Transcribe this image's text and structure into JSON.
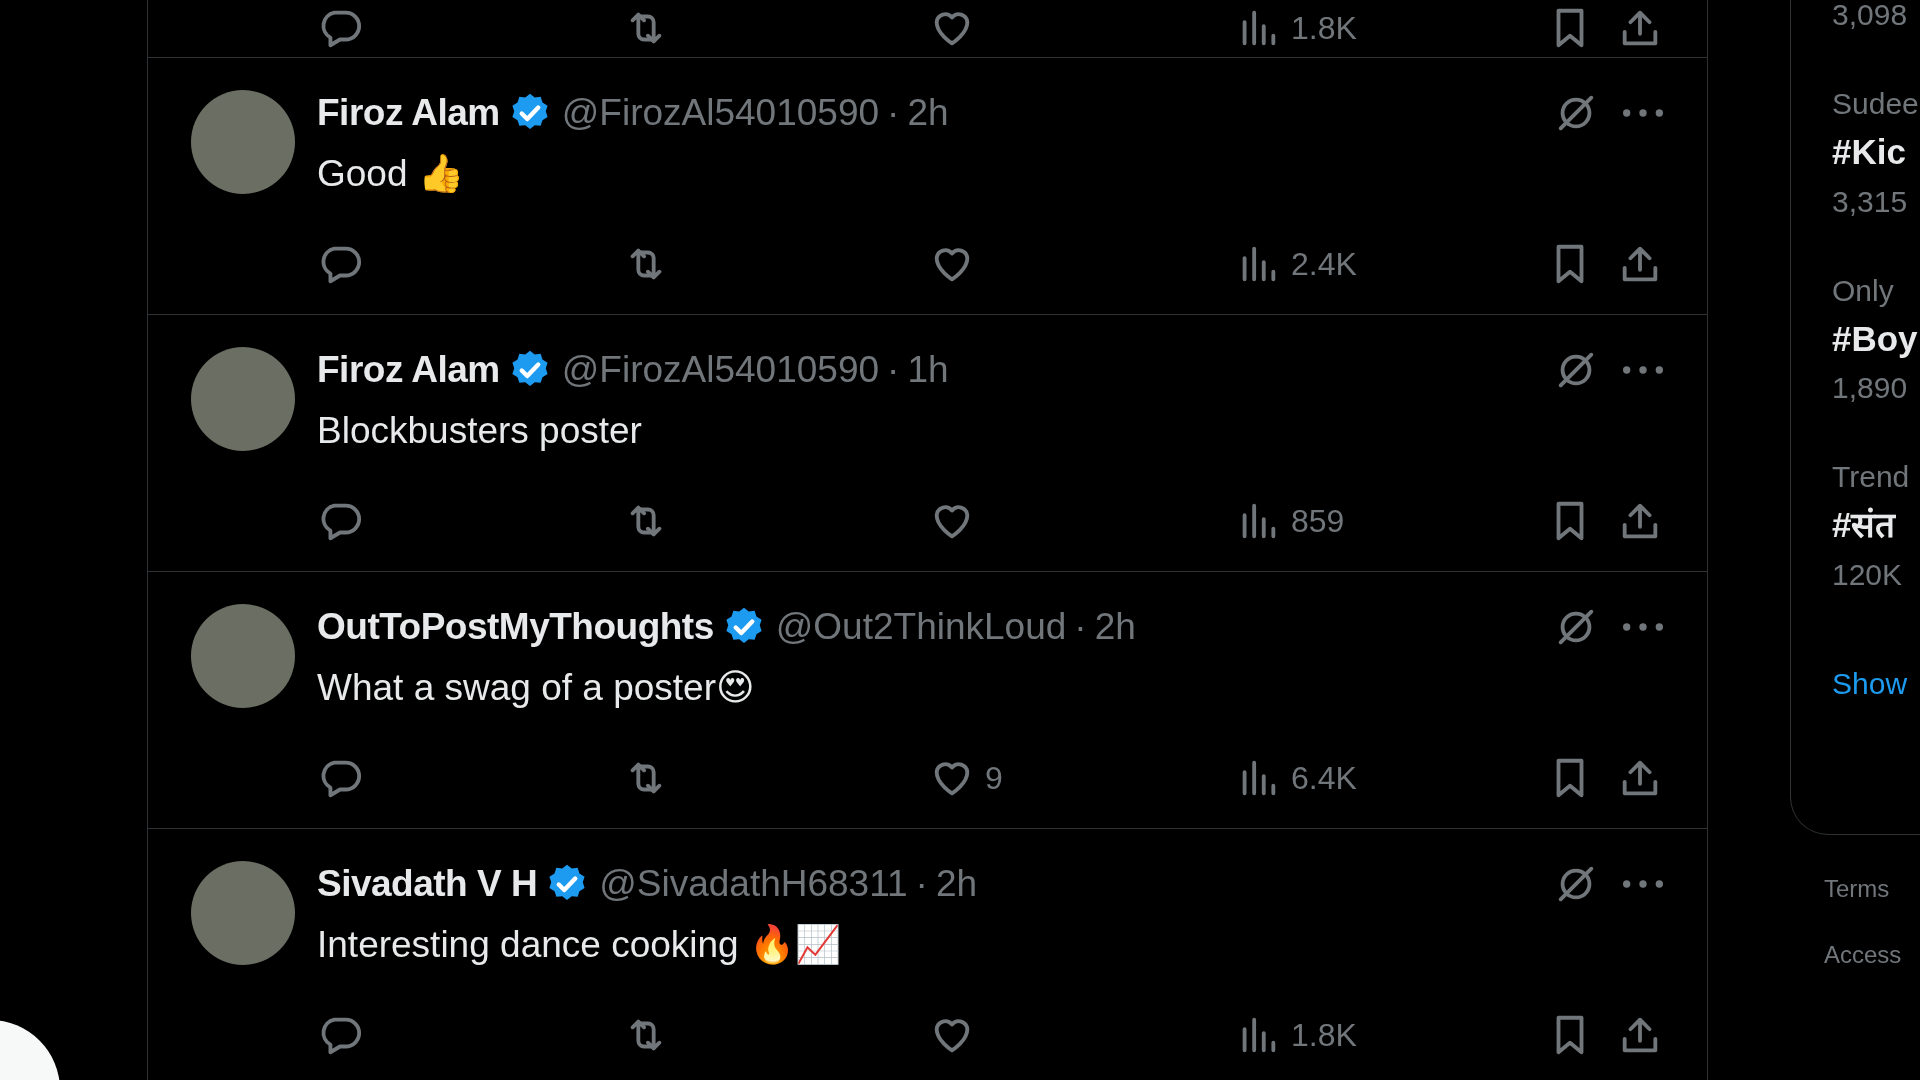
{
  "previous_tweet": {
    "views": "1.8K"
  },
  "tweets": [
    {
      "name": "Firoz Alam",
      "verified": true,
      "handle": "@FirozAl54010590",
      "separator": "·",
      "time": "2h",
      "text": "Good 👍",
      "views": "2.4K"
    },
    {
      "name": "Firoz Alam",
      "verified": true,
      "handle": "@FirozAl54010590",
      "separator": "·",
      "time": "1h",
      "text": "Blockbusters  poster",
      "views": "859"
    },
    {
      "name": "OutToPostMyThoughts",
      "verified": true,
      "handle": "@Out2ThinkLoud",
      "separator": "·",
      "time": "2h",
      "text": "What a swag of a poster😍",
      "likes": "9",
      "views": "6.4K"
    },
    {
      "name": "Sivadath V H",
      "verified": true,
      "handle": "@SivadathH68311",
      "separator": "·",
      "time": "2h",
      "text": "Interesting dance cooking 🔥📈",
      "views": "1.8K"
    }
  ],
  "trends": {
    "items": [
      {
        "count": "3,098"
      },
      {
        "context": "Sudee",
        "tag": "#Kic",
        "count": "3,315"
      },
      {
        "context": "Only",
        "tag": "#Boy",
        "count": "1,890"
      },
      {
        "context": "Trend",
        "tag": "#संत",
        "count": "120K"
      }
    ],
    "show_more": "Show"
  },
  "footer_links": [
    "Terms",
    "Access"
  ]
}
